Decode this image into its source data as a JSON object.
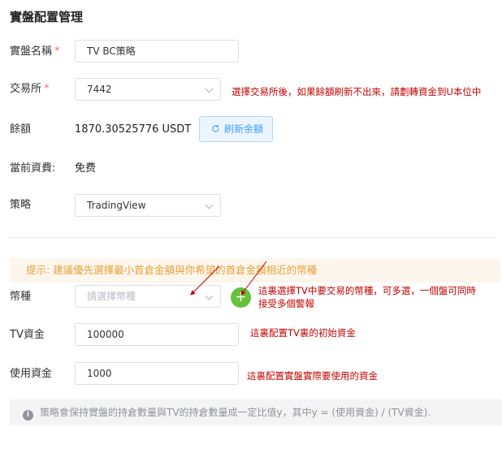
{
  "page_title": "實盤配置管理",
  "form": {
    "name": {
      "label": "實盤名稱",
      "required_mark": "*",
      "value": "TV BC策略"
    },
    "exchange": {
      "label": "交易所",
      "required_mark": "*",
      "value": "7442",
      "icon": "chevron-down-icon"
    },
    "balance": {
      "label": "餘額",
      "value": "1870.30525776 USDT",
      "refresh_label": "刷新余額",
      "refresh_icon": "refresh-icon"
    },
    "fee": {
      "label": "當前資費:",
      "value": "免费"
    },
    "strategy": {
      "label": "策略",
      "value": "TradingView",
      "icon": "chevron-down-icon"
    },
    "tip": "提示: 建議優先選擇最小首倉金額與你希望的首倉金額相近的幣種",
    "coin": {
      "label": "幣種",
      "placeholder": "請選擇幣種",
      "add_icon": "plus-icon",
      "add_symbol": "+"
    },
    "tv_capital": {
      "label": "TV資金",
      "value": "100000"
    },
    "use_capital": {
      "label": "使用資金",
      "value": "1000"
    },
    "note": "策略會保持實盤的持倉數量與TV的持倉數量成一定比值y，其中y = (使用資金) / (TV資金).",
    "note_icon": "info-icon"
  },
  "annotations": {
    "exchange": "選擇交易所後，如果餘額刷新不出來，請劃轉資金到U本位中",
    "coin_line1": "這裏選擇TV中要交易的幣種，可多選，一個盤可同時",
    "coin_line2": "接受多個警報",
    "tv_capital": "這裏配置TV裏的初始資金",
    "use_capital": "這裏配置實盤實際要使用的資金"
  },
  "colors": {
    "required": "#f56c6c",
    "annotation": "#c00000",
    "primary": "#409eff",
    "success": "#67c23a",
    "warning_text": "#e6a23c",
    "warning_bg": "#fdf6ec"
  }
}
